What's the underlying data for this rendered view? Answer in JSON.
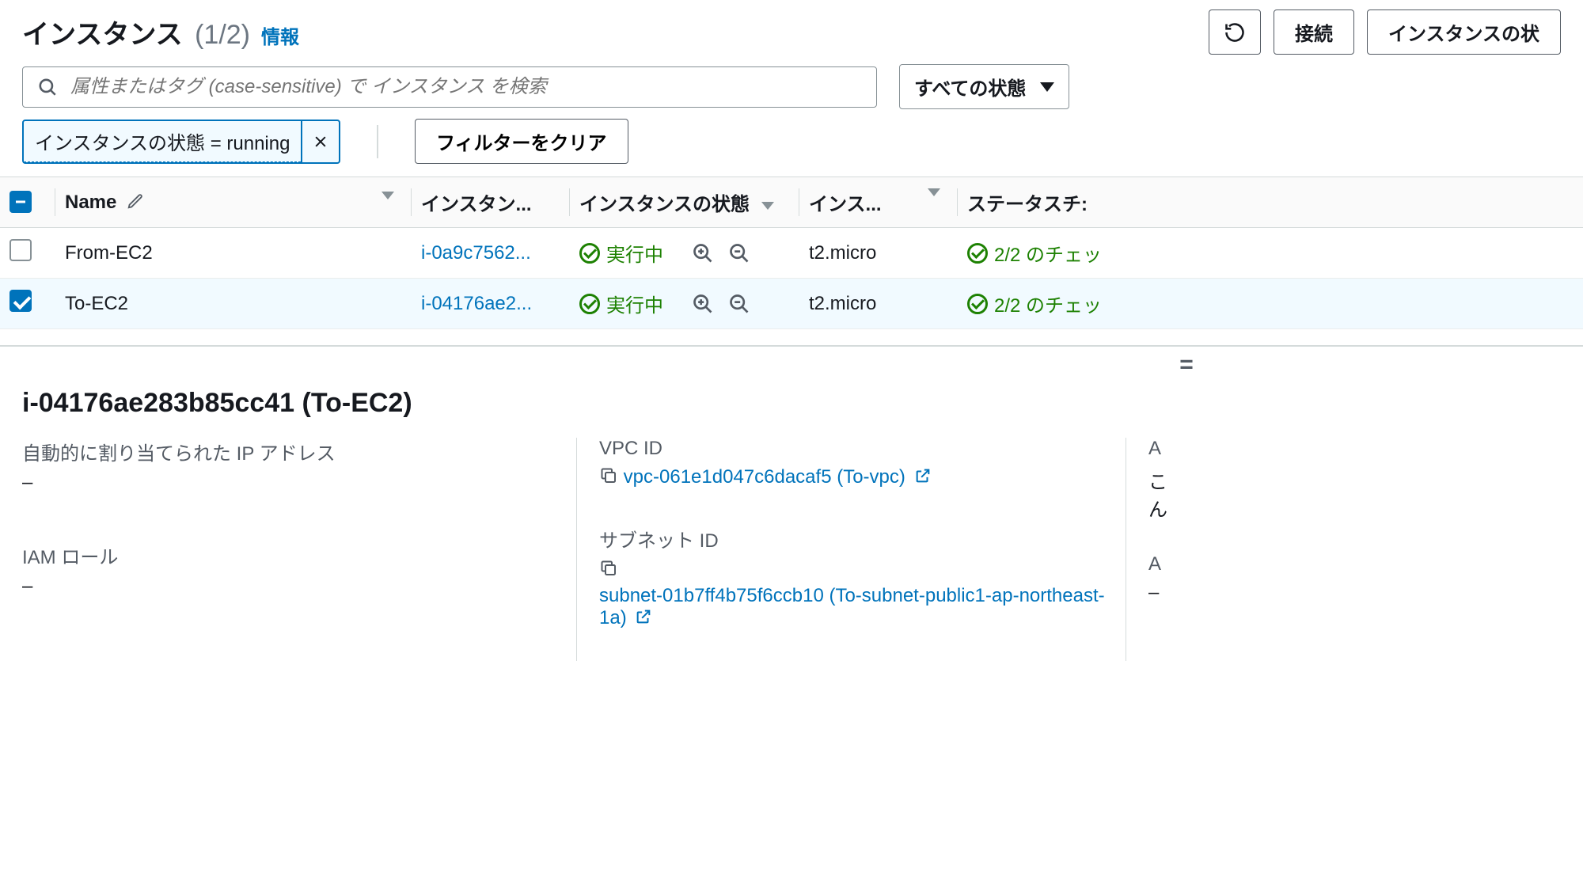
{
  "header": {
    "title": "インスタンス",
    "count_text": "(1/2)",
    "info_link": "情報",
    "connect_label": "接続",
    "state_menu_label": "インスタンスの状"
  },
  "search": {
    "placeholder": "属性またはタグ (case-sensitive) で インスタンス を検索",
    "state_filter_label": "すべての状態"
  },
  "chips": {
    "state_running": "インスタンスの状態 = running",
    "clear_label": "フィルターをクリア"
  },
  "columns": {
    "name": "Name",
    "instance_id": "インスタン...",
    "state": "インスタンスの状態",
    "type": "インス...",
    "status": "ステータスチ:"
  },
  "rows": [
    {
      "selected": false,
      "name": "From-EC2",
      "instance_id": "i-0a9c7562...",
      "state_text": "実行中",
      "type": "t2.micro",
      "status_text": "2/2 のチェッ"
    },
    {
      "selected": true,
      "name": "To-EC2",
      "instance_id": "i-04176ae2...",
      "state_text": "実行中",
      "type": "t2.micro",
      "status_text": "2/2 のチェッ"
    }
  ],
  "detail": {
    "title": "i-04176ae283b85cc41 (To-EC2)",
    "auto_ip_label": "自動的に割り当てられた IP アドレス",
    "auto_ip_value": "–",
    "vpc_label": "VPC ID",
    "vpc_value": "vpc-061e1d047c6dacaf5 (To-vpc)",
    "col3_a_1": "A",
    "col3_a_2": "こ",
    "col3_a_3": "ん",
    "iam_label": "IAM ロール",
    "iam_value": "–",
    "subnet_label": "サブネット ID",
    "subnet_value": "subnet-01b7ff4b75f6ccb10 (To-subnet-public1-ap-northeast-1a)",
    "col3_b_label": "A",
    "col3_b_value": "–"
  }
}
